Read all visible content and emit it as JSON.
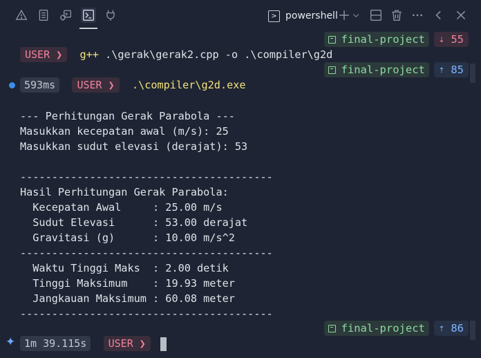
{
  "panel": {
    "icons": [
      "warning-icon",
      "output-icon",
      "debug-console-icon",
      "terminal-icon",
      "ports-icon"
    ],
    "terminal_tab_label": "powershell",
    "actions": [
      "add-terminal-icon",
      "split-terminal-icon",
      "trash-icon",
      "more-icon",
      "previous-panel-icon",
      "close-panel-icon"
    ]
  },
  "prompts": [
    {
      "user": "USER",
      "chevron": "❯",
      "cmd_exe": "g++",
      "cmd_args": " .\\gerak\\gerak2.cpp -o .\\compiler\\g2d",
      "branch": "final-project",
      "behind": "55"
    },
    {
      "time": "593ms",
      "user": "USER",
      "chevron": "❯",
      "cmd_exe": ".\\compiler\\g2d.exe",
      "branch": "final-project",
      "ahead": "85"
    },
    {
      "time": "1m 39.115s",
      "user": "USER",
      "chevron": "❯",
      "branch": "final-project",
      "ahead": "86"
    }
  ],
  "output": [
    "--- Perhitungan Gerak Parabola ---",
    "Masukkan kecepatan awal (m/s): 25",
    "Masukkan sudut elevasi (derajat): 53",
    "",
    "----------------------------------------",
    "Hasil Perhitungan Gerak Parabola:",
    "  Kecepatan Awal     : 25.00 m/s",
    "  Sudut Elevasi      : 53.00 derajat",
    "  Gravitasi (g)      : 10.00 m/s^2",
    "----------------------------------------",
    "  Waktu Tinggi Maks  : 2.00 detik",
    "  Tinggi Maksimum    : 19.93 meter",
    "  Jangkauan Maksimum : 60.08 meter",
    "----------------------------------------"
  ],
  "colors": {
    "background": "#1e2433",
    "user_segment": "#f0839a",
    "branch": "#8ed9a1",
    "ahead": "#7fb6ff",
    "command": "#f3e27b"
  }
}
